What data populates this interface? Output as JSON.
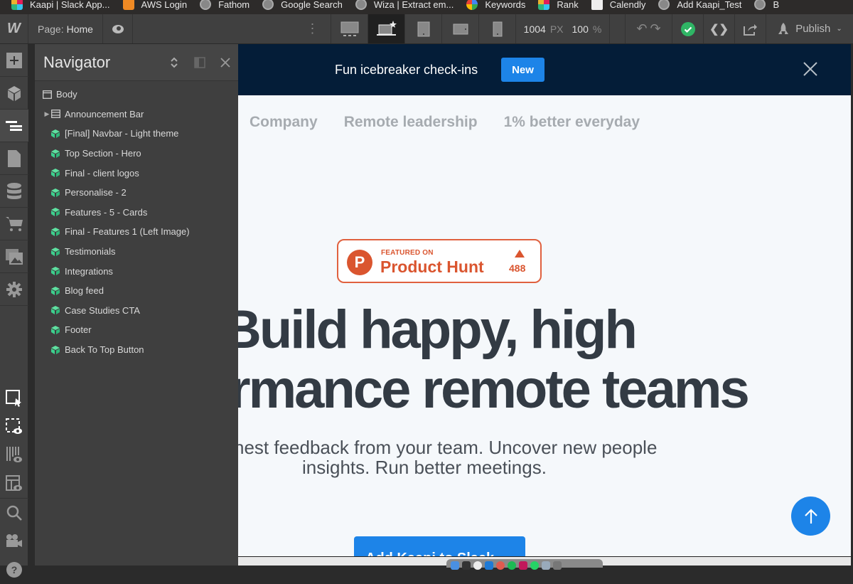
{
  "bookmarks": [
    {
      "label": "Kaapi | Slack App...",
      "icon": "slack-icon"
    },
    {
      "label": "AWS Login",
      "icon": "aws-icon"
    },
    {
      "label": "Fathom",
      "icon": "globe-icon"
    },
    {
      "label": "Google Search",
      "icon": "globe-icon"
    },
    {
      "label": "Wiza | Extract em...",
      "icon": "globe-icon"
    },
    {
      "label": "Keywords",
      "icon": "google-icon"
    },
    {
      "label": "Rank",
      "icon": "slack-icon"
    },
    {
      "label": "Calendly",
      "icon": "calendar-icon"
    },
    {
      "label": "Add Kaapi_Test",
      "icon": "globe-icon"
    },
    {
      "label": "B",
      "icon": "globe-icon"
    }
  ],
  "toolbar": {
    "logo": "W",
    "page_prefix": "Page:",
    "page_name": "Home",
    "width_value": "1004",
    "width_unit": "PX",
    "zoom_value": "100",
    "zoom_unit": "%",
    "publish_label": "Publish",
    "active_breakpoint": "desktop-base"
  },
  "navigator": {
    "title": "Navigator",
    "items": [
      {
        "label": "Body",
        "type": "body",
        "expandable": false
      },
      {
        "label": "Announcement Bar",
        "type": "section",
        "expandable": true
      },
      {
        "label": "[Final] Navbar - Light theme",
        "type": "symbol",
        "expandable": false
      },
      {
        "label": "Top Section - Hero",
        "type": "symbol",
        "expandable": false
      },
      {
        "label": "Final - client logos",
        "type": "symbol",
        "expandable": false
      },
      {
        "label": "Personalise - 2",
        "type": "symbol",
        "expandable": false
      },
      {
        "label": "Features - 5 - Cards",
        "type": "symbol",
        "expandable": false
      },
      {
        "label": "Final - Features 1 (Left Image)",
        "type": "symbol",
        "expandable": false
      },
      {
        "label": "Testimonials",
        "type": "symbol",
        "expandable": false
      },
      {
        "label": "Integrations",
        "type": "symbol",
        "expandable": false
      },
      {
        "label": "Blog feed",
        "type": "symbol",
        "expandable": false
      },
      {
        "label": "Case Studies CTA",
        "type": "symbol",
        "expandable": false
      },
      {
        "label": "Footer",
        "type": "symbol",
        "expandable": false
      },
      {
        "label": "Back To Top Button",
        "type": "symbol",
        "expandable": false
      }
    ]
  },
  "canvas": {
    "announcement": {
      "text": "Fun icebreaker check-ins",
      "badge": "New"
    },
    "nav_links": [
      "Company",
      "Remote leadership",
      "1% better everyday"
    ],
    "product_hunt": {
      "kicker": "FEATURED ON",
      "name": "Product Hunt",
      "logo_letter": "P",
      "votes": "488"
    },
    "hero_line1": "Build happy, high",
    "hero_line2": "rmance remote teams",
    "sub_line1": "nest feedback from your team. Uncover new people",
    "sub_line2": "insights. Run better meetings.",
    "cta_label": "Add Kaapi to Slack"
  },
  "colors": {
    "announce_bg": "#041d38",
    "accent_blue": "#1d84e8",
    "product_hunt": "#da552f",
    "symbol_green": "#3ecf8e",
    "status_green": "#2fb565"
  }
}
